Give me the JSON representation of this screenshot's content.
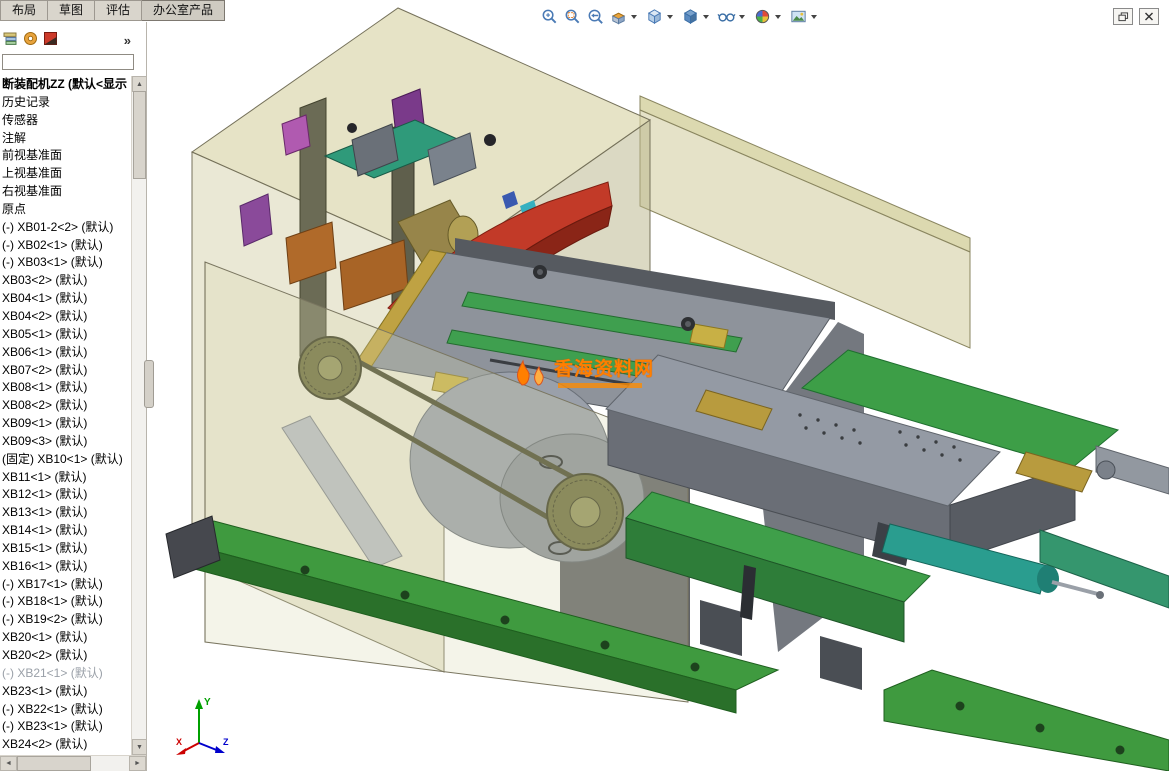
{
  "window": {
    "bg": "#ffffff"
  },
  "command_tabs": {
    "items": [
      {
        "label": "布局"
      },
      {
        "label": "草图"
      },
      {
        "label": "评估"
      },
      {
        "label": "办公室产品"
      }
    ]
  },
  "view_toolbar": {
    "icons": [
      "zoom-to-fit",
      "zoom-to-area",
      "previous-view",
      "section-view",
      "view-orientation",
      "display-style",
      "hide-show-items",
      "edit-appearance",
      "apply-scene"
    ]
  },
  "window_controls": {
    "buttons": [
      "restore",
      "close"
    ]
  },
  "feature_panel": {
    "tabs": [
      "feature-manager",
      "property-manager",
      "configuration-manager"
    ],
    "overflow_chevron": "»",
    "filter": {
      "value": "",
      "placeholder": ""
    },
    "scrollbar": {
      "up": "▲",
      "down": "▼",
      "left": "◄",
      "right": "►"
    },
    "tree": {
      "items": [
        {
          "label": "断装配机ZZ (默认<显示",
          "bold": true
        },
        {
          "label": "历史记录"
        },
        {
          "label": "传感器"
        },
        {
          "label": "注解"
        },
        {
          "label": "前视基准面"
        },
        {
          "label": "上视基准面"
        },
        {
          "label": "右视基准面"
        },
        {
          "label": "原点"
        },
        {
          "label": "(-) XB01-2<2> (默认)"
        },
        {
          "label": "(-) XB02<1> (默认)"
        },
        {
          "label": "(-) XB03<1> (默认)"
        },
        {
          "label": "XB03<2> (默认)"
        },
        {
          "label": "XB04<1> (默认)"
        },
        {
          "label": "XB04<2> (默认)"
        },
        {
          "label": "XB05<1> (默认)"
        },
        {
          "label": "XB06<1> (默认)"
        },
        {
          "label": "XB07<2> (默认)"
        },
        {
          "label": "XB08<1> (默认)"
        },
        {
          "label": "XB08<2> (默认)"
        },
        {
          "label": "XB09<1> (默认)"
        },
        {
          "label": "XB09<3> (默认)"
        },
        {
          "label": "(固定) XB10<1> (默认)"
        },
        {
          "label": "XB11<1> (默认)"
        },
        {
          "label": "XB12<1> (默认)"
        },
        {
          "label": "XB13<1> (默认)"
        },
        {
          "label": "XB14<1> (默认)"
        },
        {
          "label": "XB15<1> (默认)"
        },
        {
          "label": "XB16<1> (默认)"
        },
        {
          "label": "(-) XB17<1> (默认)"
        },
        {
          "label": "(-) XB18<1> (默认)"
        },
        {
          "label": "(-) XB19<2> (默认)"
        },
        {
          "label": "XB20<1> (默认)"
        },
        {
          "label": "XB20<2> (默认)"
        },
        {
          "label": "(-) XB21<1> (默认)",
          "gray": true
        },
        {
          "label": "XB23<1> (默认)"
        },
        {
          "label": "(-) XB22<1> (默认)"
        },
        {
          "label": "(-) XB23<1> (默认)"
        },
        {
          "label": "XB24<2> (默认)"
        }
      ]
    }
  },
  "viewport": {
    "watermark": {
      "text": "香海资料网",
      "color": "#ff7f00"
    },
    "triad": {
      "x": "X",
      "y": "Y",
      "z": "Z"
    },
    "palette": {
      "housing_tan": "#cdc89a",
      "rail_green": "#3f9a3f",
      "plate_green": "#3d9e47",
      "bed_gray": "#8e939b",
      "cylinder_teal": "#2a9d8f",
      "chute_red": "#c23a28",
      "brass_gold": "#b89b3e",
      "watermark_orange": "#ff7f00"
    }
  }
}
